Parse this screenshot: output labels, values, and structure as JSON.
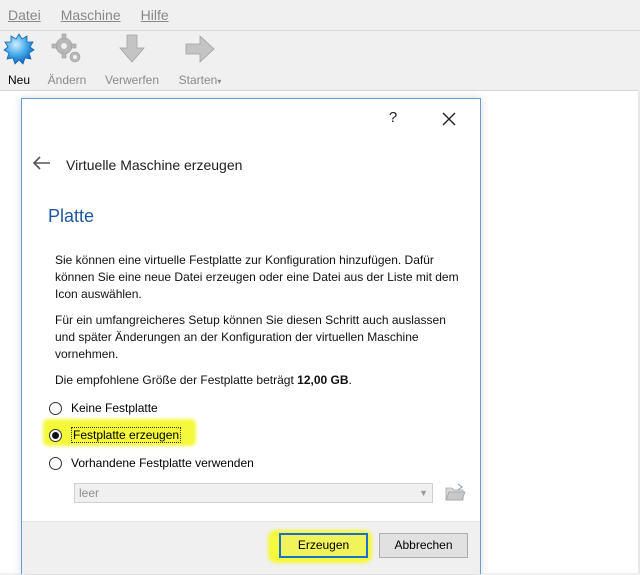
{
  "menubar": {
    "items": [
      {
        "label": "Datei"
      },
      {
        "label": "Maschine"
      },
      {
        "label": "Hilfe"
      }
    ]
  },
  "toolbar": {
    "new_label": "Neu",
    "edit_label": "Ändern",
    "discard_label": "Verwerfen",
    "start_label": "Starten"
  },
  "dialog": {
    "help": "?",
    "close": "✕",
    "wizard_title": "Virtuelle Maschine erzeugen",
    "page_title": "Platte",
    "para1": "Sie können eine virtuelle Festplatte zur Konfiguration hinzufügen. Dafür können Sie eine neue Datei erzeugen oder eine Datei aus der Liste mit dem Icon auswählen.",
    "para2": "Für ein umfangreicheres Setup können Sie diesen Schritt auch auslassen und später Änderungen an der Konfiguration der virtuellen Maschine vornehmen.",
    "para3_prefix": "Die empfohlene Größe der Festplatte beträgt ",
    "para3_size": "12,00 GB",
    "para3_suffix": ".",
    "options": [
      {
        "label": "Keine Festplatte",
        "checked": false
      },
      {
        "label": "Festplatte erzeugen",
        "checked": true
      },
      {
        "label": "Vorhandene Festplatte verwenden",
        "checked": false
      }
    ],
    "select_value": "leer",
    "create_button": "Erzeugen",
    "cancel_button": "Abbrechen"
  },
  "colors": {
    "accent": "#1f57a1",
    "highlight": "#f4f93a",
    "focus_border": "#1b6fd0"
  }
}
